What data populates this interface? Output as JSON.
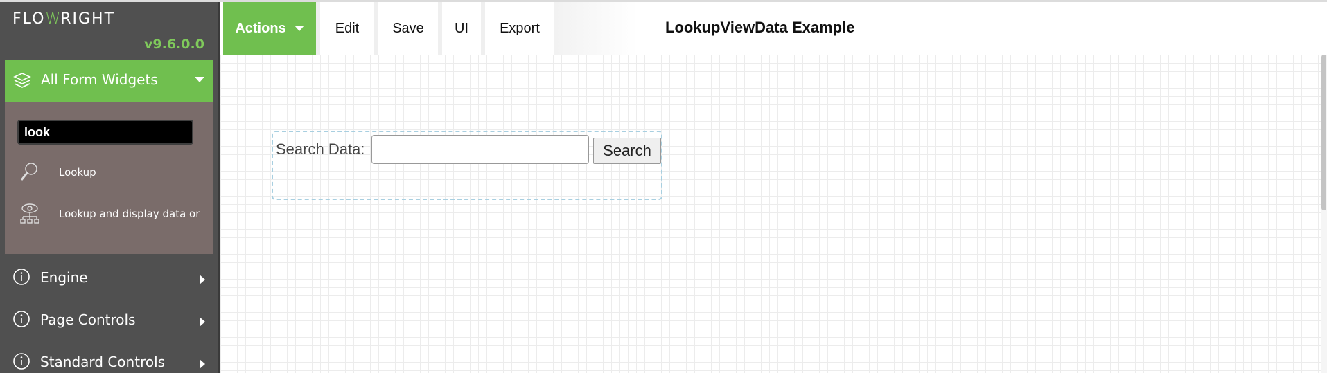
{
  "logo": {
    "part1": "FLO",
    "part2": "W",
    "part3": "RIGHT"
  },
  "version": "v9.6.0.0",
  "sidebar": {
    "active_section": {
      "label": "All Form Widgets",
      "icon": "layers-icon"
    },
    "search": {
      "value": "look"
    },
    "widgets": [
      {
        "label": "Lookup",
        "icon": "magnifier-icon"
      },
      {
        "label": "Lookup and display data or",
        "icon": "eye-network-icon"
      }
    ],
    "sections": [
      {
        "label": "Engine",
        "icon": "info-icon"
      },
      {
        "label": "Page Controls",
        "icon": "info-icon"
      },
      {
        "label": "Standard Controls",
        "icon": "info-icon"
      }
    ]
  },
  "toolbar": {
    "actions_label": "Actions",
    "edit_label": "Edit",
    "save_label": "Save",
    "ui_label": "UI",
    "export_label": "Export"
  },
  "page_title": "LookupViewData Example",
  "form": {
    "field_label": "Search Data:",
    "field_value": "",
    "button_label": "Search"
  },
  "colors": {
    "accent": "#70bf4f",
    "sidebar_bg": "#505050",
    "panel_bg": "#7a6c6a",
    "dashed_border": "#a8cfe0"
  }
}
